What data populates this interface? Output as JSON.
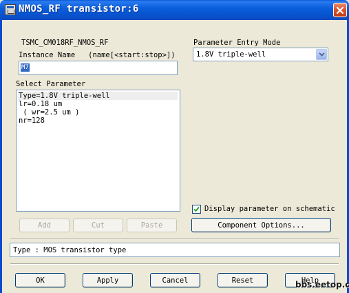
{
  "window": {
    "title": "NMOS_RF transistor:6",
    "icon": "app-icon",
    "close_icon": "close-icon"
  },
  "cell_name": "TSMC_CM018RF_NMOS_RF",
  "instance": {
    "label": "Instance Name   (name[<start:stop>])",
    "value": "M7"
  },
  "parameter_entry_mode": {
    "label": "Parameter Entry Mode",
    "selected": "1.8V triple-well"
  },
  "select_parameter": {
    "label": "Select Parameter",
    "items": [
      "Type=1.8V triple-well",
      "lr=0.18 um",
      " ( wr=2.5 um )",
      "nr=128"
    ]
  },
  "list_buttons": {
    "add": "Add",
    "cut": "Cut",
    "paste": "Paste"
  },
  "display_param": {
    "label": "Display parameter on schematic",
    "checked": true
  },
  "component_options": "Component Options...",
  "status": "Type : MOS transistor type",
  "footer_buttons": {
    "ok": "OK",
    "apply": "Apply",
    "cancel": "Cancel",
    "reset": "Reset",
    "help": "Help"
  },
  "watermark": "bbs.eetop.cn",
  "colors": {
    "titlebar": "#0a5ad8",
    "dialog_bg": "#ece9d8",
    "selection": "#316ac5",
    "close_button": "#d8542a"
  }
}
